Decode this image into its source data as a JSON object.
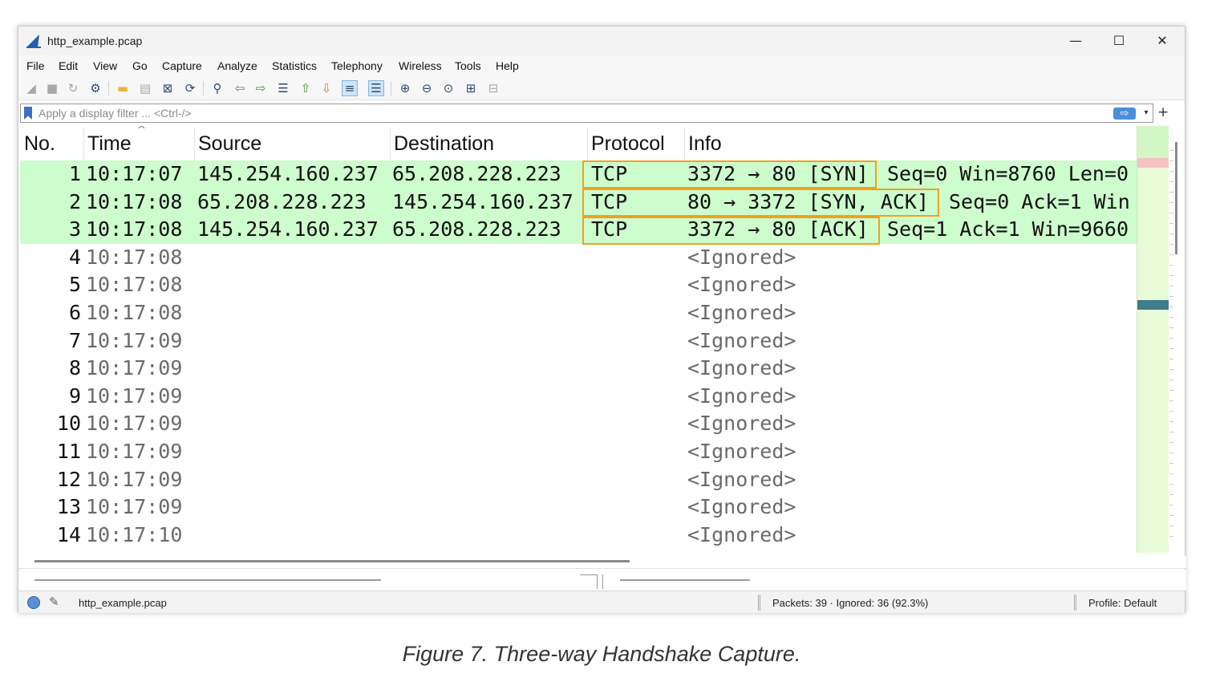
{
  "window": {
    "title": "http_example.pcap",
    "controls": {
      "minimize": "—",
      "maximize": "☐",
      "close": "✕"
    }
  },
  "menu": [
    "File",
    "Edit",
    "View",
    "Go",
    "Capture",
    "Analyze",
    "Statistics",
    "Telephony",
    "Wireless",
    "Tools",
    "Help"
  ],
  "toolbar": {
    "icons": [
      "shark-fin-start-icon",
      "stop-icon",
      "restart-icon",
      "capture-options-icon",
      "open-folder-icon",
      "save-icon",
      "close-file-icon",
      "reload-icon",
      "find-icon",
      "back-arrow-icon",
      "forward-arrow-icon",
      "go-to-packet-icon",
      "first-packet-icon",
      "last-packet-icon",
      "autoscroll-icon",
      "colorize-icon",
      "zoom-in-icon",
      "zoom-out-icon",
      "zoom-reset-icon",
      "resize-columns-icon",
      "layout-icon"
    ]
  },
  "filter": {
    "placeholder": "Apply a display filter ... <Ctrl-/>",
    "apply_arrow": "⇨",
    "dropdown": "▾",
    "add": "+"
  },
  "columns": {
    "no": "No.",
    "time": "Time",
    "source": "Source",
    "destination": "Destination",
    "protocol": "Protocol",
    "info": "Info"
  },
  "packets": [
    {
      "no": "1",
      "time": "10:17:07",
      "source": "145.254.160.237",
      "destination": "65.208.228.223",
      "protocol": "TCP",
      "info_flags": "3372 → 80 [SYN]",
      "info_rest": "Seq=0 Win=8760 Len=0",
      "handshake": true
    },
    {
      "no": "2",
      "time": "10:17:08",
      "source": "65.208.228.223",
      "destination": "145.254.160.237",
      "protocol": "TCP",
      "info_flags": "80 → 3372 [SYN, ACK]",
      "info_rest": "Seq=0 Ack=1 Win",
      "handshake": true
    },
    {
      "no": "3",
      "time": "10:17:08",
      "source": "145.254.160.237",
      "destination": "65.208.228.223",
      "protocol": "TCP",
      "info_flags": "3372 → 80 [ACK]",
      "info_rest": "Seq=1 Ack=1 Win=9660",
      "handshake": true
    },
    {
      "no": "4",
      "time": "10:17:08",
      "source": "",
      "destination": "",
      "protocol": "",
      "info_flags": "<Ignored>",
      "info_rest": "",
      "handshake": false
    },
    {
      "no": "5",
      "time": "10:17:08",
      "source": "",
      "destination": "",
      "protocol": "",
      "info_flags": "<Ignored>",
      "info_rest": "",
      "handshake": false
    },
    {
      "no": "6",
      "time": "10:17:08",
      "source": "",
      "destination": "",
      "protocol": "",
      "info_flags": "<Ignored>",
      "info_rest": "",
      "handshake": false
    },
    {
      "no": "7",
      "time": "10:17:09",
      "source": "",
      "destination": "",
      "protocol": "",
      "info_flags": "<Ignored>",
      "info_rest": "",
      "handshake": false
    },
    {
      "no": "8",
      "time": "10:17:09",
      "source": "",
      "destination": "",
      "protocol": "",
      "info_flags": "<Ignored>",
      "info_rest": "",
      "handshake": false
    },
    {
      "no": "9",
      "time": "10:17:09",
      "source": "",
      "destination": "",
      "protocol": "",
      "info_flags": "<Ignored>",
      "info_rest": "",
      "handshake": false
    },
    {
      "no": "10",
      "time": "10:17:09",
      "source": "",
      "destination": "",
      "protocol": "",
      "info_flags": "<Ignored>",
      "info_rest": "",
      "handshake": false
    },
    {
      "no": "11",
      "time": "10:17:09",
      "source": "",
      "destination": "",
      "protocol": "",
      "info_flags": "<Ignored>",
      "info_rest": "",
      "handshake": false
    },
    {
      "no": "12",
      "time": "10:17:09",
      "source": "",
      "destination": "",
      "protocol": "",
      "info_flags": "<Ignored>",
      "info_rest": "",
      "handshake": false
    },
    {
      "no": "13",
      "time": "10:17:09",
      "source": "",
      "destination": "",
      "protocol": "",
      "info_flags": "<Ignored>",
      "info_rest": "",
      "handshake": false
    },
    {
      "no": "14",
      "time": "10:17:10",
      "source": "",
      "destination": "",
      "protocol": "",
      "info_flags": "<Ignored>",
      "info_rest": "",
      "handshake": false
    }
  ],
  "colors": {
    "handshake_row": "#cdfccd",
    "highlight_box": "#f0a21c",
    "ignored_text": "#6a6a6a",
    "minimap_bg": "#e8fbd8",
    "minimap_selected": "#3f7c8c",
    "minimap_marker": "#f4c2c2"
  },
  "status": {
    "file": "http_example.pcap",
    "packets": "Packets: 39 · Ignored: 36 (92.3%)",
    "profile": "Profile: Default"
  },
  "caption": "Figure 7. Three-way Handshake Capture."
}
